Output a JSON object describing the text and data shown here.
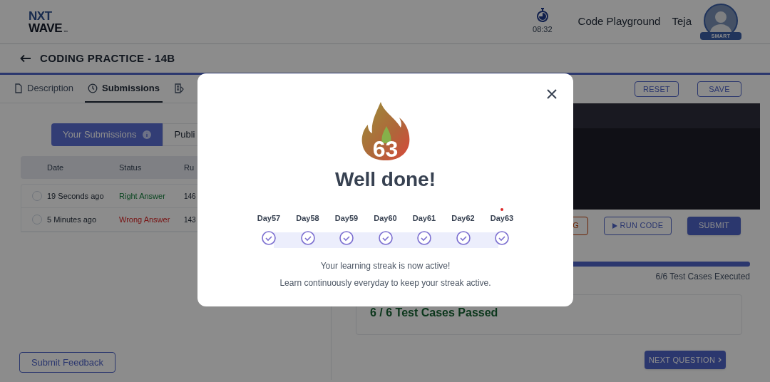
{
  "header": {
    "logo_top": "NXT",
    "logo_bottom": "WAVE",
    "logo_mark": "™",
    "timer": "08:32",
    "link": "Code Playground",
    "user_name": "Teja",
    "badge": "SMART"
  },
  "title_bar": {
    "title": "CODING PRACTICE - 14B"
  },
  "tabs": [
    {
      "label": "Description",
      "selected": false
    },
    {
      "label": "Submissions",
      "selected": true
    },
    {
      "selected": false
    }
  ],
  "submission_toggle": [
    {
      "label": "Your Submissions",
      "selected": true
    },
    {
      "label": "Publi",
      "selected": false
    }
  ],
  "table": {
    "columns": [
      "Date",
      "Status",
      "Ru"
    ],
    "rows": [
      {
        "selected": false,
        "date": "19 Seconds ago",
        "status": "Right Answer",
        "kind": "right",
        "runtime": "146"
      },
      {
        "selected": false,
        "date": "5 Minutes ago",
        "status": "Wrong Answer",
        "kind": "wrong",
        "runtime": "143"
      }
    ]
  },
  "feedback_button": "Submit Feedback",
  "editor_actions": [
    "RESET",
    "SAVE"
  ],
  "run_buttons": [
    {
      "label": "G",
      "kind": "danger"
    },
    {
      "label": "RUN CODE",
      "kind": "outline"
    },
    {
      "label": "SUBMIT",
      "kind": "primary"
    }
  ],
  "progress": {
    "level": 1,
    "reading": "6/6 Test Cases Executed"
  },
  "result": {
    "text": "6 / 6 Test Cases Passed"
  },
  "next_button": "NEXT QUESTION",
  "modal": {
    "streak": "63",
    "title": "Well done!",
    "days": [
      {
        "label": "Day57",
        "done": true,
        "today": false
      },
      {
        "label": "Day58",
        "done": true,
        "today": false
      },
      {
        "label": "Day59",
        "done": true,
        "today": false
      },
      {
        "label": "Day60",
        "done": true,
        "today": false
      },
      {
        "label": "Day61",
        "done": true,
        "today": false
      },
      {
        "label": "Day62",
        "done": true,
        "today": false
      },
      {
        "label": "Day63",
        "done": true,
        "today": true
      }
    ],
    "lines": [
      "Your learning streak is now active!",
      "Learn continuously everyday to keep your streak active."
    ]
  }
}
